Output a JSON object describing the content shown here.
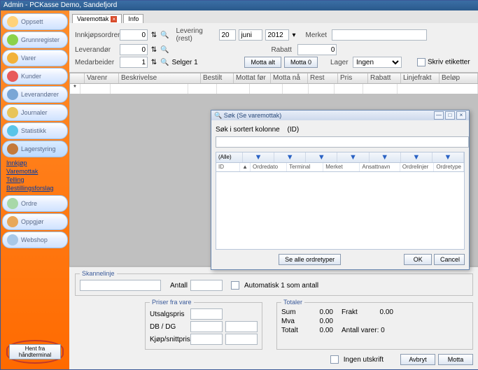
{
  "window_title": "Admin - PCKasse Demo, Sandefjord",
  "sidebar": {
    "items": [
      {
        "label": "Oppsett"
      },
      {
        "label": "Grunnregister"
      },
      {
        "label": "Varer"
      },
      {
        "label": "Kunder"
      },
      {
        "label": "Leverandører"
      },
      {
        "label": "Journaler"
      },
      {
        "label": "Statistikk"
      },
      {
        "label": "Lagerstyring"
      },
      {
        "label": "Ordre"
      },
      {
        "label": "Oppgjør"
      },
      {
        "label": "Webshop"
      }
    ],
    "sub": [
      "Innkjøp",
      "Varemottak",
      "Telling",
      "Bestillingsforslag"
    ]
  },
  "tabs": {
    "t1": "Varemottak",
    "t2": "Info"
  },
  "form": {
    "innkjopsordrenr_lbl": "Innkjøpsordrenr",
    "innkjopsordrenr": "0",
    "levering_lbl": "Levering (rest)",
    "lev_d": "20",
    "lev_m": "juni",
    "lev_y": "2012",
    "leverandor_lbl": "Leverandør",
    "leverandor": "0",
    "medarbeider_lbl": "Medarbeider",
    "medarbeider": "1",
    "selger": "Selger 1",
    "merket_lbl": "Merket",
    "merket": "",
    "rabatt_lbl": "Rabatt",
    "rabatt": "0",
    "motta_alt": "Motta alt",
    "motta_0": "Motta 0",
    "lager_lbl": "Lager",
    "lager": "Ingen",
    "skriv_etiketter": "Skriv etiketter"
  },
  "grid_cols": [
    "",
    "Varenr",
    "Beskrivelse",
    "Bestilt",
    "Mottat før",
    "Motta nå",
    "Rest",
    "Pris",
    "Rabatt",
    "Linjefrakt",
    "Beløp"
  ],
  "scan": {
    "legend": "Skannelinje",
    "antall_lbl": "Antall",
    "auto": "Automatisk 1 som antall"
  },
  "priser": {
    "legend": "Priser fra vare",
    "utsalg": "Utsalgspris",
    "dbdg": "DB / DG",
    "kjop": "Kjøp/snittpris"
  },
  "totaler": {
    "legend": "Totaler",
    "sum": "Sum",
    "sum_v": "0.00",
    "frakt": "Frakt",
    "frakt_v": "0.00",
    "mva": "Mva",
    "mva_v": "0.00",
    "totalt": "Totalt",
    "totalt_v": "0.00",
    "antvarer": "Antall varer: 0"
  },
  "footer": {
    "ingen": "Ingen utskrift",
    "avbryt": "Avbryt",
    "motta": "Motta"
  },
  "hent": "Hent fra\nhåndterminal",
  "modal": {
    "title": "Søk (Se varemottak)",
    "search_lbl": "Søk i sortert kolonne",
    "search_hint": "(ID)",
    "alle": "(Alle)",
    "cols": [
      "ID",
      "Ordredato",
      "Terminal",
      "Merket",
      "Ansattnavn",
      "Ordrelinjer",
      "Ordretype"
    ],
    "sealle": "Se alle ordretyper",
    "ok": "OK",
    "cancel": "Cancel"
  }
}
